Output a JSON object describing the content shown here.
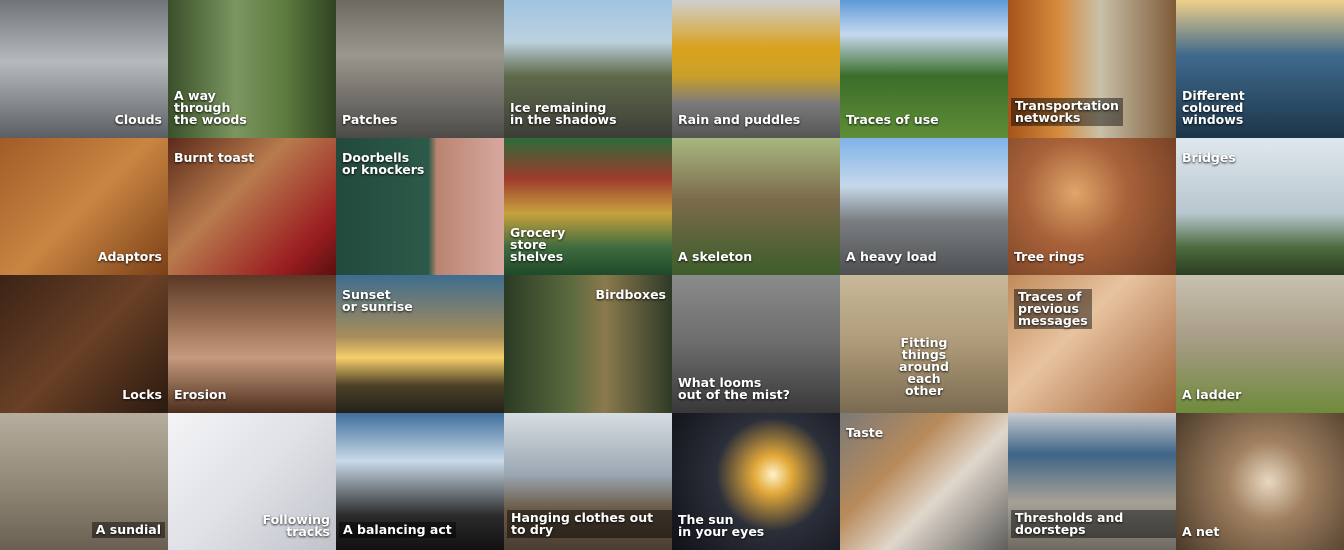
{
  "tiles": [
    {
      "label": "Clouds",
      "pos": "br",
      "bg": "linear-gradient(180deg,#707478 0%,#b7babd 45%,#5b5f63 100%)"
    },
    {
      "label": "A way\nthrough\nthe woods",
      "pos": "bl",
      "bg": "linear-gradient(90deg,#3a4f2a 0%,#7b9660 40%,#5d7a3e 70%,#2f4322 100%)"
    },
    {
      "label": "Patches",
      "pos": "bl",
      "bg": "linear-gradient(180deg,#6d6a62 0%,#9a978e 40%,#4c4b47 100%)"
    },
    {
      "label": "Ice remaining\nin the shadows",
      "pos": "bl",
      "bg": "linear-gradient(180deg,#9fc4e0 0%,#bcd1df 30%,#5f6a4a 55%,#3c3d37 100%)"
    },
    {
      "label": "Rain and puddles",
      "pos": "bl",
      "bg": "linear-gradient(180deg,#cfcfcf 0%,#d9a21c 35%,#caa02a 55%,#7a7a7a 75%,#555 100%)"
    },
    {
      "label": "Traces of use",
      "pos": "bl",
      "bg": "linear-gradient(180deg,#5d9ad8 0%,#c5d9ee 25%,#3c6d2a 55%,#5e8e36 100%)"
    },
    {
      "label": "Transportation\nnetworks",
      "pos": "bl",
      "bgLabel": true,
      "bg": "linear-gradient(90deg,#a7531a 0%,#d58b3d 30%,#c8c0a8 55%,#7e5a37 100%)"
    },
    {
      "label": "Different\ncoloured\nwindows",
      "pos": "bl",
      "bg": "linear-gradient(180deg,#f0d08a 0%,#3f6a8d 40%,#1d3549 100%)"
    },
    {
      "label": "Adaptors",
      "pos": "br",
      "bg": "linear-gradient(135deg,#a15c28 0%,#c98542 50%,#7a4018 100%)"
    },
    {
      "label": "Burnt toast",
      "pos": "tl",
      "bg": "linear-gradient(135deg,#5b2a1a 0%,#b87b4d 40%,#9b1e21 80%,#5a0f10 100%)"
    },
    {
      "label": "Doorbells\nor knockers",
      "pos": "tl",
      "bg": "linear-gradient(90deg,#23493c 0%,#2c5a49 55%,#b98570 60%,#d8a8a0 100%)"
    },
    {
      "label": "Grocery\nstore\nshelves",
      "pos": "bl",
      "bg": "linear-gradient(180deg,#2d6b3a 0%,#9e3c2c 30%,#c7a23e 55%,#3e6b3e 80%,#1f4a2a 100%)"
    },
    {
      "label": "A skeleton",
      "pos": "bl",
      "bg": "linear-gradient(180deg,#a8b87f 0%,#7b6b4c 45%,#3d5d2a 100%)"
    },
    {
      "label": "A heavy load",
      "pos": "bl",
      "bg": "linear-gradient(180deg,#7fb3e8 0%,#c6d8ea 35%,#7b7f82 60%,#4d5153 100%)"
    },
    {
      "label": "Tree rings",
      "pos": "bl",
      "bg": "radial-gradient(circle at 40% 40%,#e0a66a 0%,#a8623a 40%,#6b3a21 100%)"
    },
    {
      "label": "Bridges",
      "pos": "tl",
      "bg": "linear-gradient(180deg,#dfe8ee 0%,#b8c6cf 55%,#4c6b3e 80%,#2b3e22 100%)"
    },
    {
      "label": "Locks",
      "pos": "br",
      "bg": "linear-gradient(135deg,#3b2416 0%,#6a4026 50%,#2a1a10 100%)"
    },
    {
      "label": "Erosion",
      "pos": "bl",
      "bg": "linear-gradient(180deg,#5a3826 0%,#a3785b 40%,#c59a7e 60%,#4d2e1d 100%)"
    },
    {
      "label": "Sunset\nor sunrise",
      "pos": "tl",
      "bg": "linear-gradient(180deg,#3d6d8f 0%,#a98d5a 45%,#f5cf6a 60%,#4d4127 80%,#22211a 100%)"
    },
    {
      "label": "Birdboxes",
      "pos": "tr",
      "bg": "linear-gradient(90deg,#2b3b24 0%,#5b6a3e 40%,#8a7a4d 60%,#2e3a27 100%)"
    },
    {
      "label": "What looms\nout of the mist?",
      "pos": "bl",
      "bg": "linear-gradient(180deg,#8b8b8b 0%,#6c6c6c 50%,#383838 100%)"
    },
    {
      "label": "Fitting things\naround\neach\nother",
      "pos": "ctr",
      "bg": "linear-gradient(180deg,#c8b99a 0%,#ad9a78 50%,#7a6a50 100%)"
    },
    {
      "label": "Traces of\nprevious\nmessages",
      "pos": "tl",
      "bgLabel": true,
      "bg": "linear-gradient(135deg,#c08a5a 0%,#e8c3a0 40%,#9c5e34 100%)"
    },
    {
      "label": "A ladder",
      "pos": "bl",
      "bg": "linear-gradient(180deg,#c8c0b0 0%,#a59a82 50%,#6e8b3a 100%)"
    },
    {
      "label": "A sundial",
      "pos": "br",
      "bgLabel": true,
      "bg": "linear-gradient(180deg,#b7ad9e 0%,#948a7a 50%,#6a5f51 100%)"
    },
    {
      "label": "Following\ntracks",
      "pos": "br",
      "bg": "linear-gradient(135deg,#f4f4f6 0%,#dfe1e6 50%,#bfc3c9 100%)"
    },
    {
      "label": "A balancing act",
      "pos": "bl",
      "bgLabel": true,
      "bg": "linear-gradient(180deg,#3f6f9c 0%,#c9d9e8 35%,#2b2b2b 75%,#111 100%)"
    },
    {
      "label": "Hanging clothes out to dry",
      "pos": "bl",
      "bgLabel": true,
      "bg": "linear-gradient(180deg,#d7dde2 0%,#9aa7b3 45%,#6b5a46 70%,#4a3d31 100%)"
    },
    {
      "label": "The sun\nin your eyes",
      "pos": "bl",
      "bg": "radial-gradient(circle at 60% 45%,#fff3c8 0%,#e3a93a 15%,#2b2f3a 45%,#0f1116 100%)"
    },
    {
      "label": "Taste",
      "pos": "tl",
      "bg": "linear-gradient(135deg,#7a7a78 0%,#b88a5a 35%,#e0d7cc 60%,#5e5e5c 100%)"
    },
    {
      "label": "Thresholds and doorsteps",
      "pos": "bl",
      "bgLabel": true,
      "bg": "linear-gradient(180deg,#c6cbd0 0%,#3f6487 30%,#a5a196 65%,#6e6a60 100%)"
    },
    {
      "label": "A net",
      "pos": "bl",
      "bg": "radial-gradient(circle at 55% 50%,#e8d8c0 0%,#a08060 35%,#4a3a2a 100%)"
    }
  ]
}
